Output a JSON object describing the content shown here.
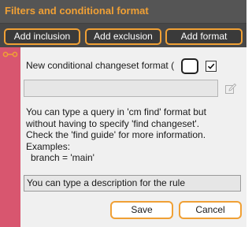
{
  "header": {
    "title": "Filters and conditional format",
    "title_color": "#f0a035"
  },
  "toolbar": {
    "add_inclusion_label": "Add inclusion",
    "add_exclusion_label": "Add exclusion",
    "add_format_label": "Add format",
    "button_border_color": "#f0a035"
  },
  "rule": {
    "strip_color": "#d8566f",
    "link_icon": "link-icon",
    "format_label": "New conditional changeset format (",
    "color_swatch": "#ffffff",
    "checkbox_checked": true,
    "query_value": "",
    "edit_icon": "edit-icon",
    "help_lines": [
      "You can type a query in 'cm find' format but",
      "without having to specify 'find changeset'.",
      "Check the 'find guide' for more information.",
      "Examples:"
    ],
    "help_example": "branch = 'main'",
    "description_placeholder": "You can type a description for the rule"
  },
  "dialog": {
    "save_label": "Save",
    "cancel_label": "Cancel"
  }
}
